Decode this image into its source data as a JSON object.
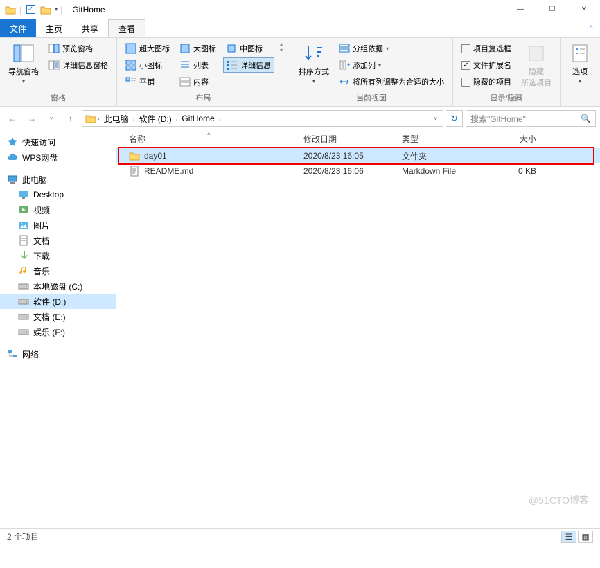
{
  "window": {
    "title": "GitHome"
  },
  "tabs": {
    "file": "文件",
    "home": "主页",
    "share": "共享",
    "view": "查看"
  },
  "ribbon": {
    "pane_group_label": "窗格",
    "nav_pane": "导航窗格",
    "preview_pane": "预览窗格",
    "details_pane": "详细信息窗格",
    "layout_group_label": "布局",
    "extra_large": "超大图标",
    "large": "大图标",
    "medium": "中图标",
    "small": "小图标",
    "list": "列表",
    "details_view": "详细信息",
    "tiles": "平铺",
    "content": "内容",
    "current_group_label": "当前视图",
    "sort_by": "排序方式",
    "group_by": "分组依据",
    "add_columns": "添加列",
    "fit_columns": "将所有列调整为合适的大小",
    "showhide_group_label": "显示/隐藏",
    "item_checkboxes": "项目复选框",
    "file_ext": "文件扩展名",
    "hidden_items": "隐藏的项目",
    "hide_selected": "隐藏\n所选项目",
    "options": "选项"
  },
  "breadcrumb": [
    "此电脑",
    "软件 (D:)",
    "GitHome"
  ],
  "search_placeholder": "搜索\"GitHome\"",
  "columns": {
    "name": "名称",
    "date": "修改日期",
    "type": "类型",
    "size": "大小"
  },
  "files": [
    {
      "name": "day01",
      "date": "2020/8/23 16:05",
      "type": "文件夹",
      "size": "",
      "kind": "folder"
    },
    {
      "name": "README.md",
      "date": "2020/8/23 16:06",
      "type": "Markdown File",
      "size": "0 KB",
      "kind": "file"
    }
  ],
  "navtree": [
    {
      "label": "快速访问",
      "icon": "star",
      "indent": 0
    },
    {
      "label": "WPS网盘",
      "icon": "cloud",
      "indent": 0
    },
    {
      "sep": true
    },
    {
      "label": "此电脑",
      "icon": "pc",
      "indent": 0
    },
    {
      "label": "Desktop",
      "icon": "desktop",
      "indent": 1
    },
    {
      "label": "视频",
      "icon": "video",
      "indent": 1
    },
    {
      "label": "图片",
      "icon": "pic",
      "indent": 1
    },
    {
      "label": "文档",
      "icon": "doc",
      "indent": 1
    },
    {
      "label": "下载",
      "icon": "down",
      "indent": 1
    },
    {
      "label": "音乐",
      "icon": "music",
      "indent": 1
    },
    {
      "label": "本地磁盘 (C:)",
      "icon": "drive",
      "indent": 1
    },
    {
      "label": "软件 (D:)",
      "icon": "drive",
      "indent": 1,
      "selected": true
    },
    {
      "label": "文档 (E:)",
      "icon": "drive",
      "indent": 1
    },
    {
      "label": "娱乐 (F:)",
      "icon": "drive",
      "indent": 1
    },
    {
      "sep": true
    },
    {
      "label": "网络",
      "icon": "net",
      "indent": 0
    }
  ],
  "status": {
    "item_count": "2 个项目"
  },
  "watermark": "@51CTO博客"
}
